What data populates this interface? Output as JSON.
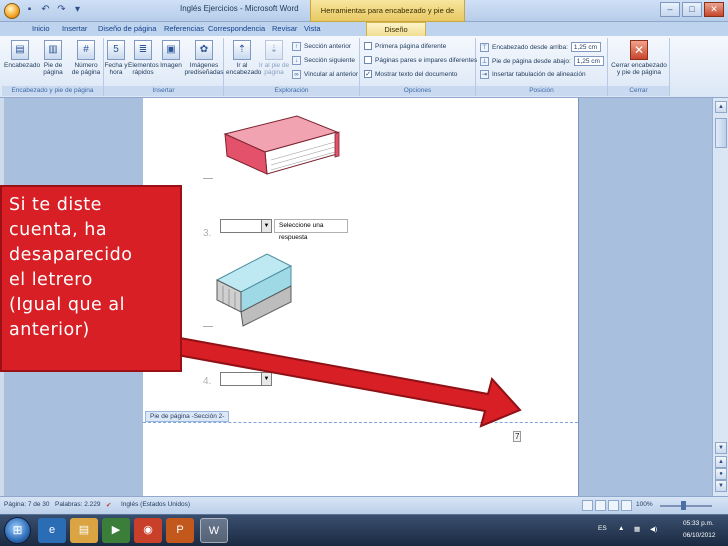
{
  "window": {
    "title": "Inglés Ejercicios - Microsoft Word",
    "contextual_title": "Herramientas para encabezado y pie de página"
  },
  "tabs": [
    "Inicio",
    "Insertar",
    "Diseño de página",
    "Referencias",
    "Correspondencia",
    "Revisar",
    "Vista",
    "Diseño"
  ],
  "ribbon": {
    "groups": {
      "header_footer": {
        "label": "Encabezado y pie de página",
        "buttons": [
          "Encabezado",
          "Pie de página",
          "Número de página"
        ]
      },
      "insert": {
        "label": "Insertar",
        "buttons": [
          "Fecha y hora",
          "Elementos rápidos",
          "Imagen",
          "Imágenes prediseñadas"
        ]
      },
      "navigation": {
        "label": "Exploración",
        "buttons": [
          "Ir al encabezado",
          "Ir al pie de página"
        ],
        "small": [
          "Sección anterior",
          "Sección siguiente",
          "Vincular al anterior"
        ]
      },
      "options": {
        "label": "Opciones",
        "checks": [
          {
            "label": "Primera página diferente",
            "checked": false
          },
          {
            "label": "Páginas pares e impares diferentes",
            "checked": false
          },
          {
            "label": "Mostrar texto del documento",
            "checked": true
          }
        ]
      },
      "position": {
        "label": "Posición",
        "rows": [
          {
            "label": "Encabezado desde arriba:",
            "value": "1,25 cm"
          },
          {
            "label": "Pie de página desde abajo:",
            "value": "1,25 cm"
          },
          {
            "label": "Insertar tabulación de alineación",
            "value": ""
          }
        ]
      },
      "close": {
        "label": "Cerrar",
        "button": "Cerrar encabezado y pie de página"
      }
    }
  },
  "document": {
    "question3_number": "3.",
    "question4_number": "4.",
    "answer_text": "Seleccione una respuesta",
    "footer_tag": "Pie de página -Sección 2-",
    "page_number": "7"
  },
  "callout": {
    "text": "Si te diste\ncuenta, ha\ndesaparecido\nel letrero\n(Igual que al\nanterior)"
  },
  "statusbar": {
    "page": "Página: 7 de 30",
    "words": "Palabras: 2.229",
    "language": "Inglés (Estados Unidos)",
    "zoom": "100%"
  },
  "taskbar": {
    "lang": "ES",
    "time": "05:33 p.m.",
    "date": "06/10/2012"
  },
  "colors": {
    "callout": "#d81f26",
    "arrow": "#d81f26",
    "book": "#e4516b",
    "eraser": "#9fd9e6"
  }
}
